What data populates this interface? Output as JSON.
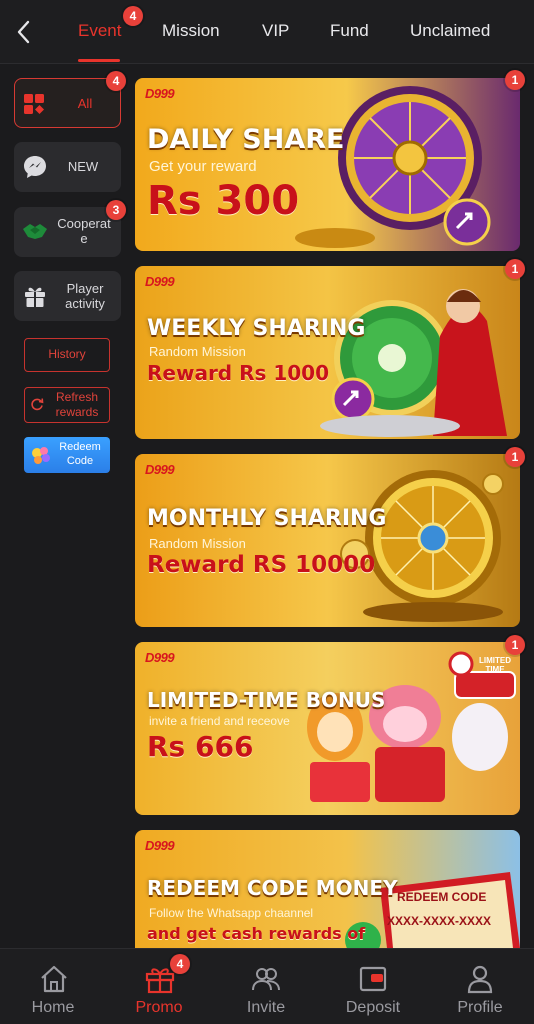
{
  "tabs": [
    {
      "label": "Event",
      "badge": "4",
      "active": true
    },
    {
      "label": "Mission"
    },
    {
      "label": "VIP"
    },
    {
      "label": "Fund"
    },
    {
      "label": "Unclaimed"
    }
  ],
  "sidebar": {
    "items": [
      {
        "label": "All",
        "badge": "4",
        "icon": "grid-icon",
        "active": true
      },
      {
        "label": "NEW",
        "icon": "chat-bubble-icon"
      },
      {
        "label": "Cooperat e",
        "badge": "3",
        "icon": "handshake-icon"
      },
      {
        "label": "Player activity",
        "icon": "gift-icon"
      }
    ],
    "history_label": "History",
    "refresh_label": "Refresh rewards",
    "redeem_label": "Redeem Code"
  },
  "banners": [
    {
      "brand": "D999",
      "title": "DAILY SHARE",
      "subtitle": "Get your reward",
      "reward": "Rs 300",
      "badge": "1"
    },
    {
      "brand": "D999",
      "title": "WEEKLY SHARING",
      "subtitle": "Random Mission",
      "reward": "Reward Rs 1000",
      "badge": "1"
    },
    {
      "brand": "D999",
      "title": "MONTHLY SHARING",
      "subtitle": "Random Mission",
      "reward": "Reward RS 10000",
      "badge": "1"
    },
    {
      "brand": "D999",
      "title": "LIMITED-TIME BONUS",
      "subtitle": "invite a friend and receove",
      "reward": "Rs 666",
      "badge": "1",
      "tag": "LIMITED TIME"
    },
    {
      "brand": "D999",
      "title": "REDEEM CODE MONEY",
      "subtitle": "Follow the Whatsapp chaannel",
      "subtitle2": "and get cash rewards of",
      "code_title": "REDEEM CODE",
      "code_value": "XXXX-XXXX-XXXX"
    }
  ],
  "bottom_nav": [
    {
      "label": "Home",
      "icon": "home-icon"
    },
    {
      "label": "Promo",
      "icon": "gift-icon",
      "badge": "4",
      "active": true
    },
    {
      "label": "Invite",
      "icon": "people-icon"
    },
    {
      "label": "Deposit",
      "icon": "wallet-icon"
    },
    {
      "label": "Profile",
      "icon": "person-icon"
    }
  ],
  "colors": {
    "accent": "#e8342c",
    "background": "#1b1b1d",
    "banner_gold": "#f0b12a"
  }
}
